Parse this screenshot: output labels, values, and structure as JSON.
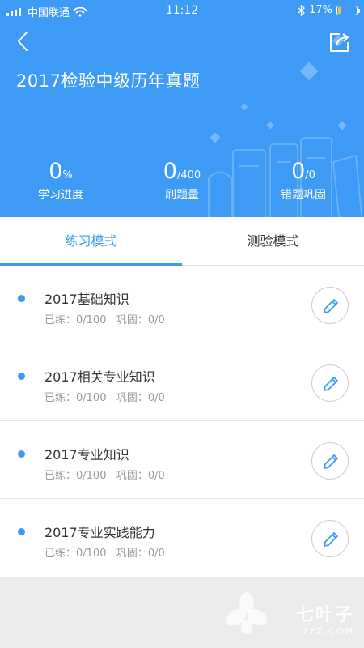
{
  "status_bar": {
    "carrier": "中国联通",
    "time": "11:12",
    "battery": "17%",
    "battery_level": 0.17
  },
  "header": {
    "back_icon": "chevron-left-icon",
    "share_icon": "share-icon",
    "title": "2017检验中级历年真题"
  },
  "stats": [
    {
      "value": "0",
      "unit": "%",
      "label": "学习进度"
    },
    {
      "value": "0",
      "unit": "/400",
      "label": "刷题量"
    },
    {
      "value": "0",
      "unit": "/0",
      "label": "错题巩固"
    }
  ],
  "tabs": [
    {
      "label": "练习模式",
      "active": true
    },
    {
      "label": "测验模式",
      "active": false
    }
  ],
  "items": [
    {
      "title": "2017基础知识",
      "sub": "已练：0/100   巩固：0/0"
    },
    {
      "title": "2017相关专业知识",
      "sub": "已练：0/100   巩固：0/0"
    },
    {
      "title": " 2017专业知识",
      "sub": "已练：0/100   巩固：0/0"
    },
    {
      "title": " 2017专业实践能力",
      "sub": "已练：0/100   巩固：0/0"
    }
  ],
  "watermark": {
    "cn": "七叶子",
    "en": "7YZ.COM"
  },
  "colors": {
    "primary": "#3d9bf5",
    "battery": "#f5c042",
    "background": "#ebebee"
  }
}
